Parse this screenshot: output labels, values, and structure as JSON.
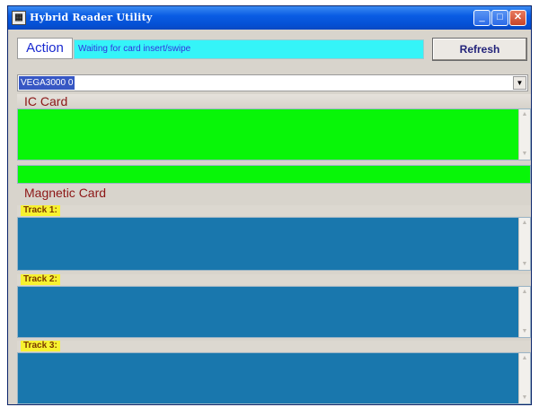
{
  "window": {
    "title": "Hybrid Reader Utility",
    "icon": "card-reader-app-icon",
    "controls": {
      "minimize": "_",
      "maximize": "□",
      "close": "✕"
    }
  },
  "action": {
    "label": "Action",
    "status": "Waiting for card insert/swipe",
    "refresh_label": "Refresh"
  },
  "reader": {
    "selected": "VEGA3000 0"
  },
  "ic_card": {
    "header": "IC Card",
    "content": "",
    "result": ""
  },
  "magnetic_card": {
    "header": "Magnetic Card",
    "tracks": [
      {
        "label": "Track 1:",
        "content": ""
      },
      {
        "label": "Track 2:",
        "content": ""
      },
      {
        "label": "Track 3:",
        "content": ""
      }
    ]
  },
  "colors": {
    "title_bar": "#0a5ce4",
    "status_bg": "#35f4f8",
    "ic_area": "#08f608",
    "track_area": "#1977ad",
    "track_label_bg": "#f7f230",
    "section_header_text": "#8c1616"
  }
}
